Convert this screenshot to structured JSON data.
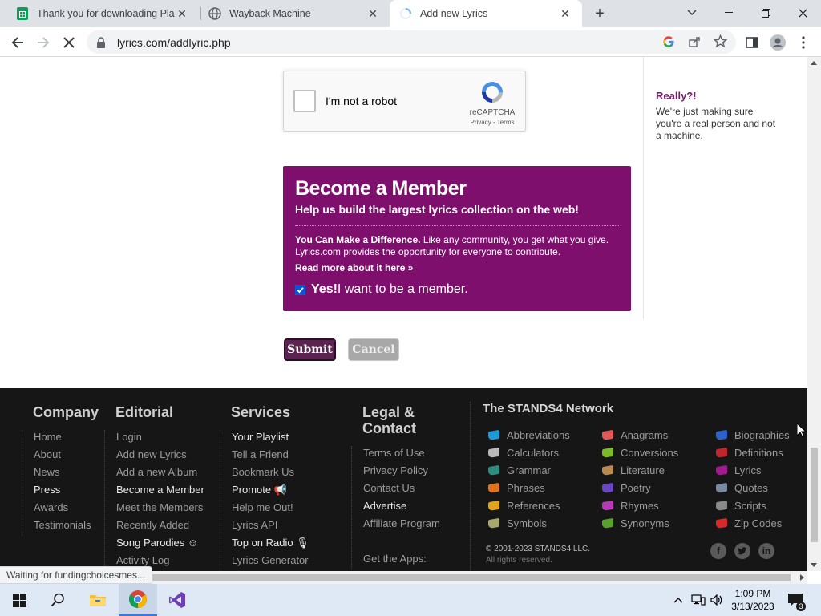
{
  "browser": {
    "tabs": [
      {
        "title": "Thank you for downloading Plant",
        "close": "✕"
      },
      {
        "title": "Wayback Machine",
        "close": "✕"
      },
      {
        "title": "Add new Lyrics",
        "close": "✕"
      }
    ],
    "new_tab": "+",
    "url": "lyrics.com/addlyric.php",
    "status_text": "Waiting for fundingchoicesmes..."
  },
  "recaptcha": {
    "label": "I'm not a robot",
    "brand": "reCAPTCHA",
    "terms": "Privacy - Terms"
  },
  "sidebar": {
    "heading": "Really?!",
    "text": "We're just making sure you're a real person and not a machine."
  },
  "member_box": {
    "title": "Become a Member",
    "subtitle": "Help us build the largest lyrics collection on the web!",
    "body_lead": "You Can Make a Difference.",
    "body_text": " Like any community, you get what you give. Lyrics.com provides the opportunity for everyone to contribute.",
    "read_more": "Read more about it here »",
    "checkbox_bold": "Yes!",
    "checkbox_text": " I want to be a member.",
    "checked": true
  },
  "buttons": {
    "submit": "Submit",
    "cancel": "Cancel"
  },
  "footer": {
    "company": {
      "heading": "Company",
      "items": [
        "Home",
        "About",
        "News",
        "Press",
        "Awards",
        "Testimonials"
      ]
    },
    "editorial": {
      "heading": "Editorial",
      "items": [
        "Login",
        "Add new Lyrics",
        "Add a new Album",
        "Become a Member",
        "Meet the Members",
        "Recently Added",
        "Song Parodies ☺",
        "Activity Log"
      ]
    },
    "services": {
      "heading": "Services",
      "items": [
        "Your Playlist",
        "Tell a Friend",
        "Bookmark Us",
        "Promote 📢",
        "Help me Out!",
        "Lyrics API",
        "Top on Radio 🎙",
        "Lyrics Generator"
      ]
    },
    "legal": {
      "heading": "Legal & Contact",
      "items": [
        "Terms of Use",
        "Privacy Policy",
        "Contact Us",
        "Advertise",
        "Affiliate Program"
      ],
      "apps": "Get the Apps:"
    },
    "network": {
      "heading": "The STANDS4 Network",
      "items": [
        {
          "label": "Abbreviations",
          "color": "#1e9bd7"
        },
        {
          "label": "Anagrams",
          "color": "#e05a5a"
        },
        {
          "label": "Biographies",
          "color": "#2e62c9"
        },
        {
          "label": "Calculators",
          "color": "#b8b8b8"
        },
        {
          "label": "Conversions",
          "color": "#7cbb2a"
        },
        {
          "label": "Definitions",
          "color": "#c0262e"
        },
        {
          "label": "Grammar",
          "color": "#2f8c7f"
        },
        {
          "label": "Literature",
          "color": "#b88a52"
        },
        {
          "label": "Lyrics",
          "color": "#a01b8d"
        },
        {
          "label": "Phrases",
          "color": "#e0731f"
        },
        {
          "label": "Poetry",
          "color": "#6a47c2"
        },
        {
          "label": "Quotes",
          "color": "#7a8aa0"
        },
        {
          "label": "References",
          "color": "#e2a31c"
        },
        {
          "label": "Rhymes",
          "color": "#b33bb3"
        },
        {
          "label": "Scripts",
          "color": "#8a8a8a"
        },
        {
          "label": "Symbols",
          "color": "#a8a86a"
        },
        {
          "label": "Synonyms",
          "color": "#5aa02e"
        },
        {
          "label": "Zip Codes",
          "color": "#d62a2a"
        }
      ],
      "copyright": "© 2001-2023 STANDS4 LLC.",
      "rights": "All rights reserved."
    }
  },
  "taskbar": {
    "time": "1:09 PM",
    "date": "3/13/2023",
    "notifications": "3"
  }
}
